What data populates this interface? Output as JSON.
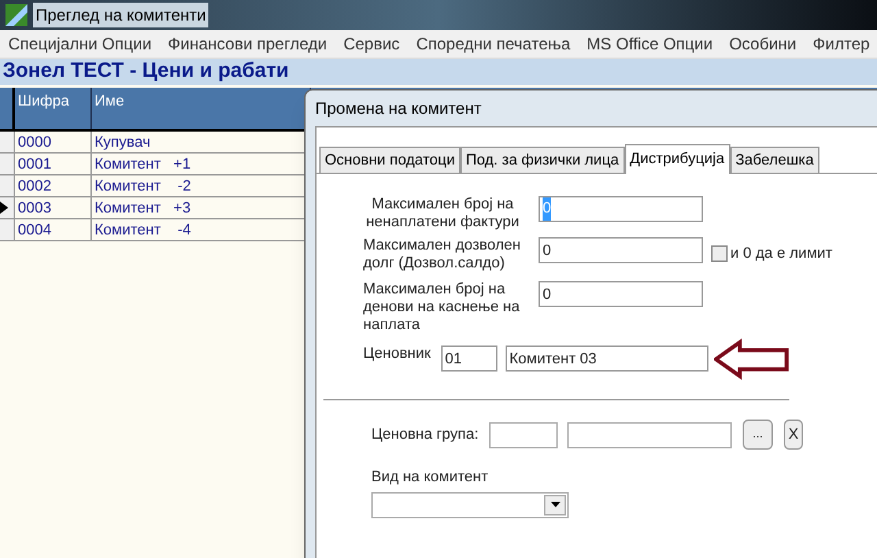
{
  "window": {
    "title": "Преглед на комитенти"
  },
  "menu": [
    "Специјални Опции",
    "Финансови прегледи",
    "Сервис",
    "Споредни печатења",
    "MS Office Опции",
    "Особини",
    "Филтер"
  ],
  "header": "Зонел ТЕСТ - Цени и рабати",
  "table": {
    "columns": [
      "Шифра",
      "Име"
    ],
    "rows": [
      {
        "code": "0000",
        "name": "Купувач",
        "selected": false
      },
      {
        "code": "0001",
        "name": "Комитент   +1",
        "selected": false
      },
      {
        "code": "0002",
        "name": "Комитент    -2",
        "selected": false
      },
      {
        "code": "0003",
        "name": "Комитент   +3",
        "selected": true
      },
      {
        "code": "0004",
        "name": "Комитент    -4",
        "selected": false
      }
    ]
  },
  "dialog": {
    "title": "Промена на комитент",
    "tabs": [
      {
        "label": "Основни податоци",
        "selected": false
      },
      {
        "label": "Под. за физички лица",
        "selected": false
      },
      {
        "label": "Дистрибуција",
        "selected": true
      },
      {
        "label": "Забелешка",
        "selected": false
      }
    ],
    "max_invoices": {
      "label": "Максимален број на ненаплатени фактури",
      "value": "0"
    },
    "max_debt": {
      "label": "Максимален дозволен долг   (Дозвол.салдо)",
      "value": "0",
      "checkbox": {
        "label": "и 0 да е лимит",
        "checked": false
      }
    },
    "max_days": {
      "label": "Максимален број на денови на каснење на наплата",
      "value": "0"
    },
    "price_list": {
      "label": "Ценовник",
      "code": "01",
      "name": "Комитент 03"
    },
    "price_group": {
      "label": "Ценовна група:",
      "browse": "...",
      "clear": "X"
    },
    "client_type": {
      "label": "Вид на комитент"
    }
  }
}
